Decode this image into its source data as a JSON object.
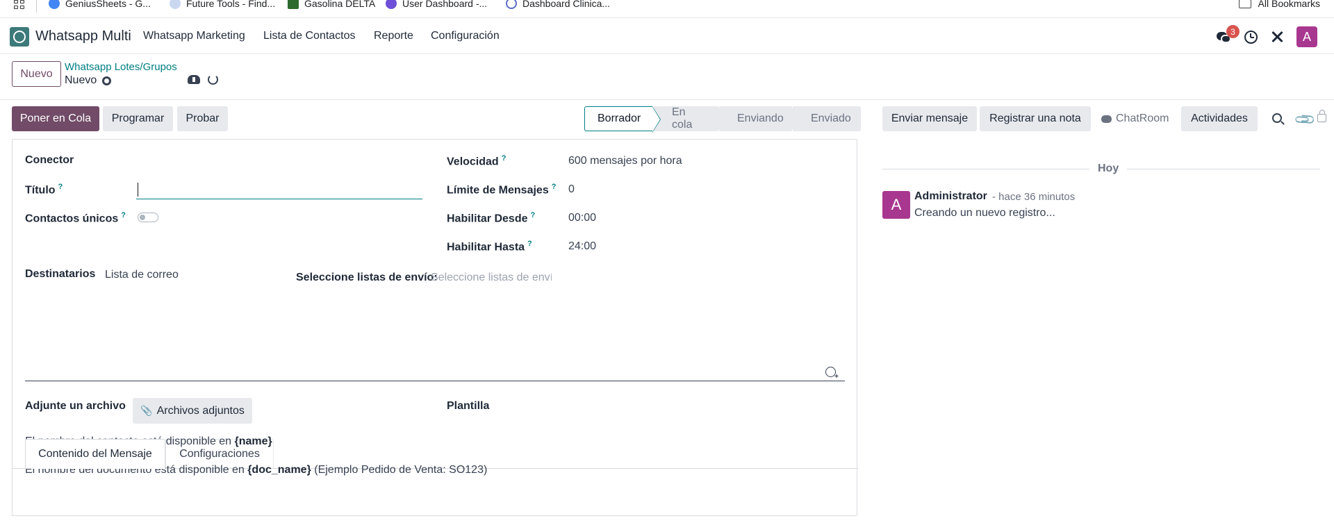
{
  "bookmarks": {
    "items": [
      {
        "label": "GeniusSheets - G...",
        "color": "#4285f4"
      },
      {
        "label": "Future Tools - Find...",
        "color": "#7b9fd6"
      },
      {
        "label": "Gasolina DELTA",
        "color": "#2d6a2d"
      },
      {
        "label": "User Dashboard -...",
        "color": "#6d4fd8"
      },
      {
        "label": "Dashboard Clinica...",
        "color": "#5a6cc8"
      }
    ],
    "all_label": "All Bookmarks"
  },
  "navbar": {
    "app_name": "Whatsapp Multi",
    "menu": [
      "Whatsapp Marketing",
      "Lista de Contactos",
      "Reporte",
      "Configuración"
    ],
    "message_count": "3",
    "user_initial": "A"
  },
  "control": {
    "new_label": "Nuevo",
    "breadcrumb": "Whatsapp Lotes/Grupos",
    "record_name": "Nuevo"
  },
  "actions": {
    "queue": "Poner en Cola",
    "schedule": "Programar",
    "test": "Probar"
  },
  "statusbar": {
    "stages": [
      "Borrador",
      "En cola",
      "Enviando",
      "Enviado"
    ],
    "current": "Borrador"
  },
  "form": {
    "connector_label": "Conector",
    "title_label": "Título",
    "title_value": "",
    "unique_label": "Contactos únicos",
    "unique_value": false,
    "speed_label": "Velocidad",
    "speed_value": "600 mensajes por hora",
    "limit_label": "Límite de Mensajes",
    "limit_value": "0",
    "from_label": "Habilitar Desde",
    "from_value": "00:00",
    "until_label": "Habilitar Hasta",
    "until_value": "24:00",
    "recipients_label": "Destinatarios",
    "recipients_value": "Lista de correo",
    "lists_label": "Seleccione listas de envío:",
    "lists_placeholder": "Seleccione listas de envío",
    "help_mark": "?"
  },
  "tabs": [
    "Contenido del Mensaje",
    "Configuraciones"
  ],
  "message": {
    "attach_label": "Adjunte un archivo",
    "attach_button": "Archivos adjuntos",
    "template_label": "Plantilla",
    "hint1_pre": "El nombre del contacto está disponible en ",
    "hint1_var": "{name}",
    "hint2_pre": "El nombre del documento está disponible en ",
    "hint2_var": "{doc_name}",
    "hint2_post": " (Ejemplo Pedido de Venta: SO123)"
  },
  "chatter": {
    "send_message": "Enviar mensaje",
    "log_note": "Registrar una nota",
    "chatroom": "ChatRoom",
    "activities": "Actividades",
    "today": "Hoy",
    "author_initial": "A",
    "author": "Administrator",
    "time": "- hace 36 minutos",
    "body": "Creando un nuevo registro..."
  },
  "colors": {
    "primary": "#714b67",
    "accent": "#017e84",
    "avatar": "#a8378f",
    "badge": "#d9534f"
  }
}
